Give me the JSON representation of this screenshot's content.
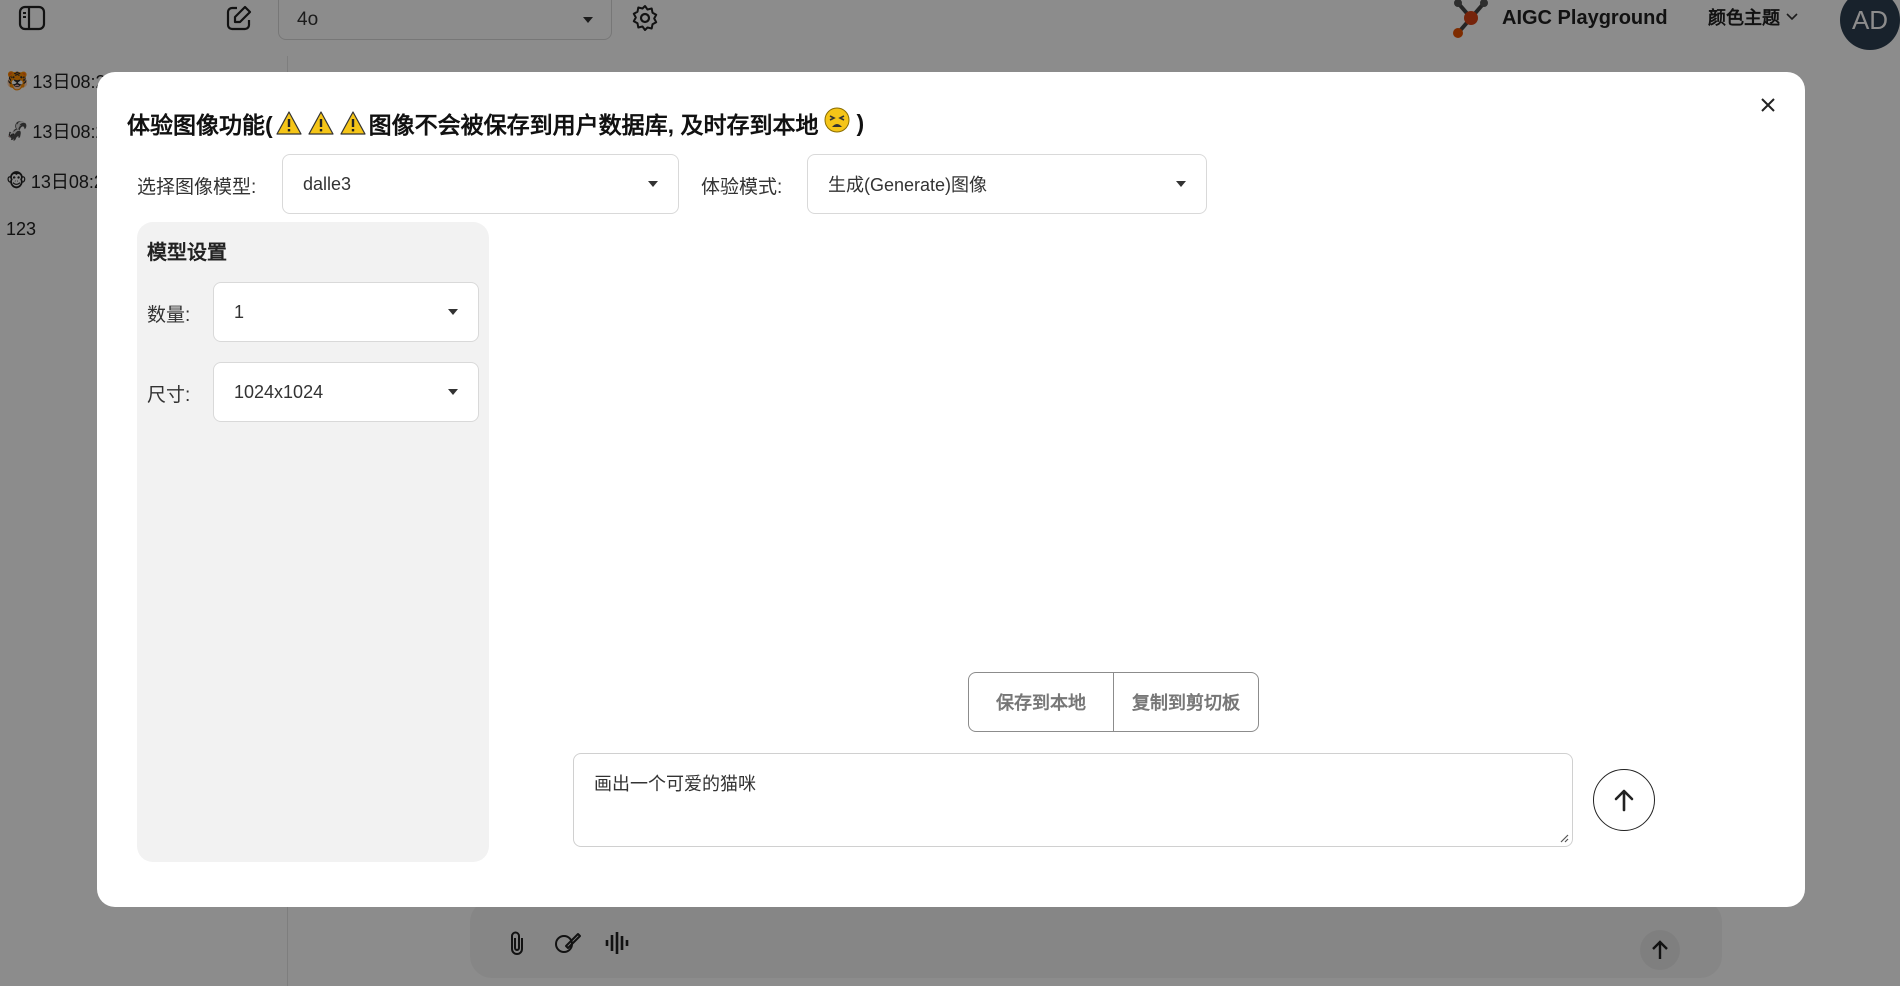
{
  "topbar": {
    "model_value": "4o",
    "brand": "AIGC Playground",
    "theme_label": "颜色主题",
    "avatar_initials": "AD"
  },
  "sidebar": {
    "items": [
      {
        "emoji": "🐯",
        "label": "13日08:2"
      },
      {
        "emoji": "🦨",
        "label": "13日08:2"
      },
      {
        "emoji": "🐵",
        "label": "13日08:2"
      },
      {
        "emoji": "",
        "label": "123"
      }
    ]
  },
  "modal": {
    "title_prefix": "体验图像功能(",
    "title_warnings": [
      "⚠",
      "⚠",
      "⚠"
    ],
    "title_text": "图像不会被保存到用户数据库, 及时存到本地",
    "title_emoji": "😫",
    "title_suffix": ")",
    "model_label": "选择图像模型:",
    "model_value": "dalle3",
    "mode_label": "体验模式:",
    "mode_value": "生成(Generate)图像",
    "settings": {
      "title": "模型设置",
      "quantity_label": "数量:",
      "quantity_value": "1",
      "size_label": "尺寸:",
      "size_value": "1024x1024"
    },
    "save_label": "保存到本地",
    "copy_label": "复制到剪切板",
    "prompt_value": "画出一个可爱的猫咪"
  },
  "colors": {
    "overlay": "#000000",
    "avatar_bg": "#2c3e50",
    "settings_bg": "#f2f2f2",
    "warning": "#f5c518"
  }
}
